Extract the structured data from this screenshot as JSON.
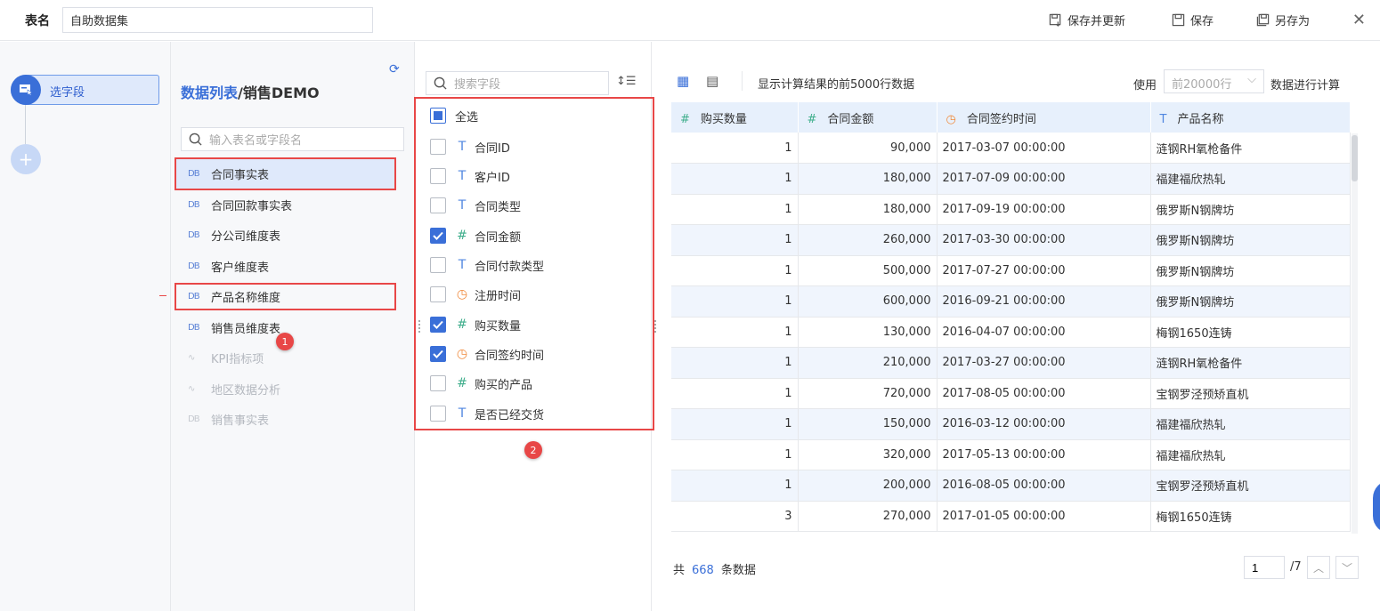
{
  "topbar": {
    "table_name_label": "表名",
    "table_name_value": "自助数据集",
    "save_update_label": "保存并更新",
    "save_label": "保存",
    "save_as_label": "另存为",
    "close_icon": "close-icon"
  },
  "steps": {
    "active_label": "选字段",
    "add_icon": "plus-icon"
  },
  "tables": {
    "breadcrumb_root": "数据列表",
    "breadcrumb_sep": "/",
    "breadcrumb_current": "销售DEMO",
    "search_placeholder": "输入表名或字段名",
    "items": [
      {
        "label": "合同事实表"
      },
      {
        "label": "合同回款事实表"
      },
      {
        "label": "分公司维度表"
      },
      {
        "label": "客户维度表"
      },
      {
        "label": "产品名称维度"
      },
      {
        "label": "销售员维度表"
      },
      {
        "label": "KPI指标项"
      },
      {
        "label": "地区数据分析"
      },
      {
        "label": "销售事实表"
      }
    ],
    "badge1": "1"
  },
  "fields": {
    "search_placeholder": "搜索字段",
    "select_all": "全选",
    "items": [
      {
        "label": "合同ID",
        "type": "T"
      },
      {
        "label": "客户ID",
        "type": "T"
      },
      {
        "label": "合同类型",
        "type": "T"
      },
      {
        "label": "合同金额",
        "type": "#"
      },
      {
        "label": "合同付款类型",
        "type": "T"
      },
      {
        "label": "注册时间",
        "type": "clock"
      },
      {
        "label": "购买数量",
        "type": "#"
      },
      {
        "label": "合同签约时间",
        "type": "clock"
      },
      {
        "label": "购买的产品",
        "type": "#"
      },
      {
        "label": "是否已经交货",
        "type": "T"
      }
    ],
    "badge2": "2"
  },
  "preview": {
    "info_text": "显示计算结果的前5000行数据",
    "use_label": "使用",
    "rows_placeholder": "前20000行",
    "calc_label": "数据进行计算",
    "columns": [
      {
        "type": "#",
        "label": "购买数量"
      },
      {
        "type": "#",
        "label": "合同金额"
      },
      {
        "type": "clock",
        "label": "合同签约时间"
      },
      {
        "type": "T",
        "label": "产品名称"
      }
    ],
    "rows": [
      [
        "1",
        "90,000",
        "2017-03-07 00:00:00",
        "涟钢RH氧枪备件"
      ],
      [
        "1",
        "180,000",
        "2017-07-09 00:00:00",
        "福建福欣热轧"
      ],
      [
        "1",
        "180,000",
        "2017-09-19 00:00:00",
        "俄罗斯N钢牌坊"
      ],
      [
        "1",
        "260,000",
        "2017-03-30 00:00:00",
        "俄罗斯N钢牌坊"
      ],
      [
        "1",
        "500,000",
        "2017-07-27 00:00:00",
        "俄罗斯N钢牌坊"
      ],
      [
        "1",
        "600,000",
        "2016-09-21 00:00:00",
        "俄罗斯N钢牌坊"
      ],
      [
        "1",
        "130,000",
        "2016-04-07 00:00:00",
        "梅钢1650连铸"
      ],
      [
        "1",
        "210,000",
        "2017-03-27 00:00:00",
        "涟钢RH氧枪备件"
      ],
      [
        "1",
        "720,000",
        "2017-08-05 00:00:00",
        "宝钢罗泾预矫直机"
      ],
      [
        "1",
        "150,000",
        "2016-03-12 00:00:00",
        "福建福欣热轧"
      ],
      [
        "1",
        "320,000",
        "2017-05-13 00:00:00",
        "福建福欣热轧"
      ],
      [
        "1",
        "200,000",
        "2016-08-05 00:00:00",
        "宝钢罗泾预矫直机"
      ],
      [
        "3",
        "270,000",
        "2017-01-05 00:00:00",
        "梅钢1650连铸"
      ]
    ],
    "total_prefix": "共",
    "total_count": "668",
    "total_suffix": "条数据",
    "page_value": "1",
    "page_total": "/7"
  }
}
